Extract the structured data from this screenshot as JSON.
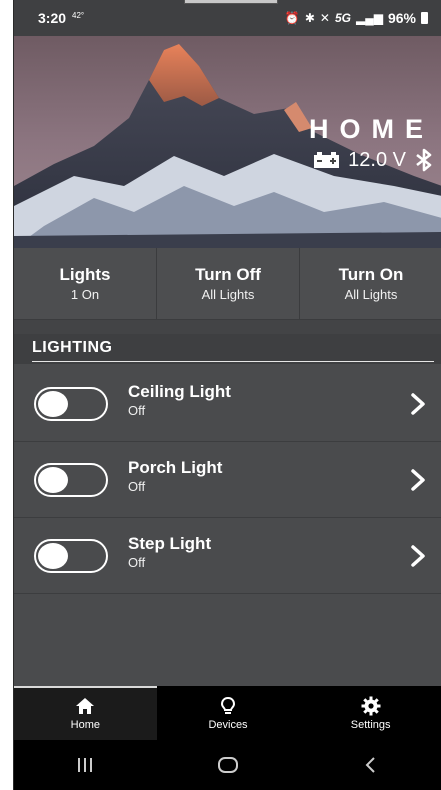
{
  "status_bar": {
    "time": "3:20",
    "temperature": "42°",
    "network": "5G",
    "battery_percent": "96%"
  },
  "hero": {
    "title": "HOME",
    "voltage": "12.0 V",
    "battery_icon": "car-battery-icon",
    "bluetooth_icon": "bluetooth-icon"
  },
  "summary": {
    "lights": {
      "label": "Lights",
      "sub": "1 On"
    },
    "turn_off": {
      "label": "Turn Off",
      "sub": "All Lights"
    },
    "turn_on": {
      "label": "Turn On",
      "sub": "All Lights"
    }
  },
  "section": {
    "title": "LIGHTING"
  },
  "lights": [
    {
      "name": "Ceiling Light",
      "state": "Off",
      "on": false
    },
    {
      "name": "Porch Light",
      "state": "Off",
      "on": false
    },
    {
      "name": "Step Light",
      "state": "Off",
      "on": false
    }
  ],
  "nav": {
    "items": [
      {
        "label": "Home",
        "icon": "home-icon",
        "active": true
      },
      {
        "label": "Devices",
        "icon": "lightbulb-icon",
        "active": false
      },
      {
        "label": "Settings",
        "icon": "gear-icon",
        "active": false
      }
    ]
  },
  "system_bar": {
    "recents_icon": "recents-icon",
    "home_icon": "home-circle-icon",
    "back_icon": "back-icon"
  }
}
